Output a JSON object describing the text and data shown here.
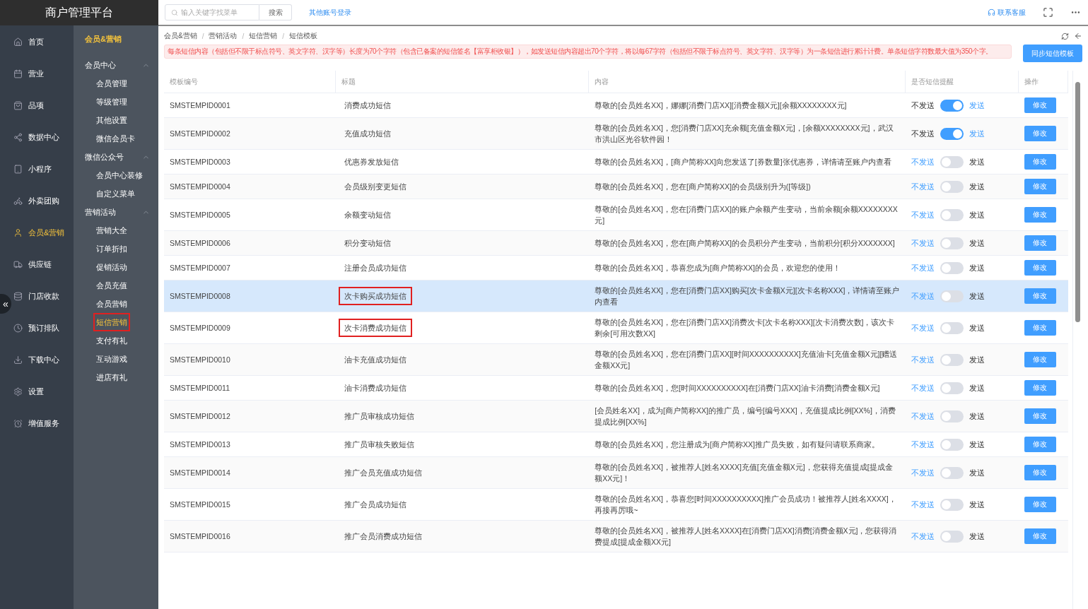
{
  "app_title": "商户管理平台",
  "collapse_button": "«",
  "sidebar": {
    "items": [
      {
        "label": "首页",
        "selected": false
      },
      {
        "label": "营业",
        "selected": false
      },
      {
        "label": "品项",
        "selected": false
      },
      {
        "label": "数据中心",
        "selected": false
      },
      {
        "label": "小程序",
        "selected": false
      },
      {
        "label": "外卖团购",
        "selected": false
      },
      {
        "label": "会员&营销",
        "selected": true
      },
      {
        "label": "供应链",
        "selected": false
      },
      {
        "label": "门店收款",
        "selected": false
      },
      {
        "label": "预订排队",
        "selected": false
      },
      {
        "label": "下载中心",
        "selected": false
      },
      {
        "label": "设置",
        "selected": false
      },
      {
        "label": "增值服务",
        "selected": false
      }
    ]
  },
  "submenu": {
    "title": "会员&营销",
    "groups": [
      {
        "label": "会员中心",
        "expanded": true,
        "items": [
          {
            "label": "会员管理",
            "selected": false,
            "highlighted": false
          },
          {
            "label": "等级管理",
            "selected": false,
            "highlighted": false
          },
          {
            "label": "其他设置",
            "selected": false,
            "highlighted": false
          },
          {
            "label": "微信会员卡",
            "selected": false,
            "highlighted": false
          }
        ]
      },
      {
        "label": "微信公众号",
        "expanded": true,
        "items": [
          {
            "label": "会员中心装修",
            "selected": false,
            "highlighted": false
          },
          {
            "label": "自定义菜单",
            "selected": false,
            "highlighted": false
          }
        ]
      },
      {
        "label": "营销活动",
        "expanded": true,
        "items": [
          {
            "label": "营销大全",
            "selected": false,
            "highlighted": false
          },
          {
            "label": "订单折扣",
            "selected": false,
            "highlighted": false
          },
          {
            "label": "促销活动",
            "selected": false,
            "highlighted": false
          },
          {
            "label": "会员充值",
            "selected": false,
            "highlighted": false
          },
          {
            "label": "会员营销",
            "selected": false,
            "highlighted": false
          },
          {
            "label": "短信营销",
            "selected": true,
            "highlighted": true
          },
          {
            "label": "支付有礼",
            "selected": false,
            "highlighted": false
          },
          {
            "label": "互动游戏",
            "selected": false,
            "highlighted": false
          },
          {
            "label": "进店有礼",
            "selected": false,
            "highlighted": false
          }
        ]
      }
    ]
  },
  "topbar": {
    "search": {
      "placeholder": "输入关键字找菜单",
      "button": "搜索"
    },
    "link": "其他账号登录",
    "support": "联系客服"
  },
  "breadcrumb": [
    "会员&营销",
    "营销活动",
    "短信营销",
    "短信模板"
  ],
  "breadcrumb_separator": "/",
  "notice": "每条短信内容（包括但不限于标点符号、英文字符、汉字等）长度为70个字符（包含已备案的短信签名【富享柜收银】），如发送短信内容超出70个字符，将以每67字符（包括但不限于标点符号、英文字符、汉字等）为一条短信进行累计计费。单条短信字符数最大值为350个字。",
  "sync_button": "同步短信模板",
  "table": {
    "columns": [
      "模板编号",
      "标题",
      "内容",
      "是否短信提醒",
      "操作"
    ],
    "rows": [
      {
        "id": "SMSTEMPID0001",
        "title": "消费成功短信",
        "title_boxed": false,
        "content": "尊敬的[会员姓名XX]，娜娜[消费门店XX][消费金额X元][余额XXXXXXXX元]",
        "send": true,
        "off_label": "不发送",
        "on_label": "发送",
        "action": "修改",
        "selected": false
      },
      {
        "id": "SMSTEMPID0002",
        "title": "充值成功短信",
        "title_boxed": false,
        "content": "尊敬的[会员姓名XX]，您[消费门店XX]充余额[充值金额X元]，[余额XXXXXXXX元]，武汉市洪山区光谷软件园！",
        "send": true,
        "off_label": "不发送",
        "on_label": "发送",
        "action": "修改",
        "selected": false
      },
      {
        "id": "SMSTEMPID0003",
        "title": "优惠券发放短信",
        "title_boxed": false,
        "content": "尊敬的[会员姓名XX]，[商户简称XX]向您发送了[券数量]张优惠券，详情请至账户内查看",
        "send": false,
        "off_label": "不发送",
        "on_label": "发送",
        "action": "修改",
        "selected": false
      },
      {
        "id": "SMSTEMPID0004",
        "title": "会员级别变更短信",
        "title_boxed": false,
        "content": "尊敬的[会员姓名XX]，您在[商户简称XX]的会员级别升为([等级])",
        "send": false,
        "off_label": "不发送",
        "on_label": "发送",
        "action": "修改",
        "selected": false
      },
      {
        "id": "SMSTEMPID0005",
        "title": "余额变动短信",
        "title_boxed": false,
        "content": "尊敬的[会员姓名XX]，您在[消费门店XX]的账户余额产生变动，当前余额[余额XXXXXXXX元]",
        "send": false,
        "off_label": "不发送",
        "on_label": "发送",
        "action": "修改",
        "selected": false
      },
      {
        "id": "SMSTEMPID0006",
        "title": "积分变动短信",
        "title_boxed": false,
        "content": "尊敬的[会员姓名XX]，您在[商户简称XX]的会员积分产生变动，当前积分[积分XXXXXXX]",
        "send": false,
        "off_label": "不发送",
        "on_label": "发送",
        "action": "修改",
        "selected": false
      },
      {
        "id": "SMSTEMPID0007",
        "title": "注册会员成功短信",
        "title_boxed": false,
        "content": "尊敬的[会员姓名XX]，恭喜您成为[商户简称XX]的会员，欢迎您的使用！",
        "send": false,
        "off_label": "不发送",
        "on_label": "发送",
        "action": "修改",
        "selected": false
      },
      {
        "id": "SMSTEMPID0008",
        "title": "次卡购买成功短信",
        "title_boxed": true,
        "content": "尊敬的[会员姓名XX]，您在[消费门店XX]购买[次卡金额X元][次卡名称XXX]，详情请至账户内查看",
        "send": false,
        "off_label": "不发送",
        "on_label": "发送",
        "action": "修改",
        "selected": true
      },
      {
        "id": "SMSTEMPID0009",
        "title": "次卡消费成功短信",
        "title_boxed": true,
        "content": "尊敬的[会员姓名XX]，您在[消费门店XX]消费次卡[次卡名称XXX][次卡消费次数]，该次卡剩余[可用次数XX]",
        "send": false,
        "off_label": "不发送",
        "on_label": "发送",
        "action": "修改",
        "selected": false
      },
      {
        "id": "SMSTEMPID0010",
        "title": "油卡充值成功短信",
        "title_boxed": false,
        "content": "尊敬的[会员姓名XX]，您在[消费门店XX][时间XXXXXXXXXX]充值油卡[充值金额X元][赠送金额XX元]",
        "send": false,
        "off_label": "不发送",
        "on_label": "发送",
        "action": "修改",
        "selected": false
      },
      {
        "id": "SMSTEMPID0011",
        "title": "油卡消费成功短信",
        "title_boxed": false,
        "content": "尊敬的[会员姓名XX]，您[时间XXXXXXXXXX]在[消费门店XX]油卡消费[消费金额X元]",
        "send": false,
        "off_label": "不发送",
        "on_label": "发送",
        "action": "修改",
        "selected": false
      },
      {
        "id": "SMSTEMPID0012",
        "title": "推广员审核成功短信",
        "title_boxed": false,
        "content": "[会员姓名XX]，成为[商户简称XX]的推广员，编号[编号XXX]，充值提成比例[XX%]，消费提成比例[XX%]",
        "send": false,
        "off_label": "不发送",
        "on_label": "发送",
        "action": "修改",
        "selected": false
      },
      {
        "id": "SMSTEMPID0013",
        "title": "推广员审核失败短信",
        "title_boxed": false,
        "content": "尊敬的[会员姓名XX]，您注册成为[商户简称XX]推广员失败，如有疑问请联系商家。",
        "send": false,
        "off_label": "不发送",
        "on_label": "发送",
        "action": "修改",
        "selected": false
      },
      {
        "id": "SMSTEMPID0014",
        "title": "推广会员充值成功短信",
        "title_boxed": false,
        "content": "尊敬的[会员姓名XX]，被推荐人[姓名XXXX]充值[充值金额X元]，您获得充值提成[提成金额XX元]！",
        "send": false,
        "off_label": "不发送",
        "on_label": "发送",
        "action": "修改",
        "selected": false
      },
      {
        "id": "SMSTEMPID0015",
        "title": "推广会员成功短信",
        "title_boxed": false,
        "content": "尊敬的[会员姓名XX]，恭喜您[时间XXXXXXXXXX]推广会员成功！被推荐人[姓名XXXX]，再接再厉哦~",
        "send": false,
        "off_label": "不发送",
        "on_label": "发送",
        "action": "修改",
        "selected": false
      },
      {
        "id": "SMSTEMPID0016",
        "title": "推广会员消费成功短信",
        "title_boxed": false,
        "content": "尊敬的[会员姓名XX]，被推荐人[姓名XXXX]在[消费门店XX]消费[消费金额X元]，您获得消费提成[提成金额XX元]",
        "send": false,
        "off_label": "不发送",
        "on_label": "发送",
        "action": "修改",
        "selected": false
      }
    ]
  }
}
